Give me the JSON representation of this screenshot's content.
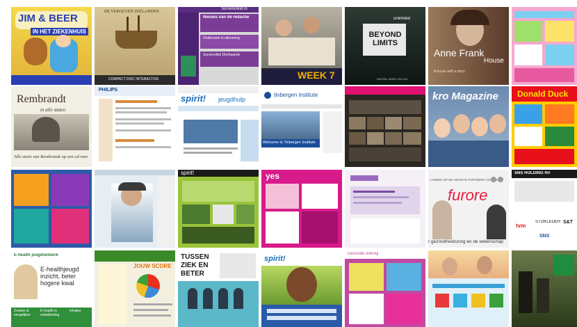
{
  "tiles": {
    "r1c1": {
      "title": "JIM & BEER",
      "subtitle": "IN HET ZIEKENHUIS"
    },
    "r1c2": {
      "title": "DE VERGEVEN ZEELANDEN",
      "subtitle": "COMPACT DISC INTERACTIVE"
    },
    "r1c3": {
      "logo": "Surveoolkid.nl",
      "heading": "Nieuws van de redactie",
      "links": [
        "Onderzoek in uitvoering",
        "Surveoolkid Dierbaarste"
      ]
    },
    "r1c4": {
      "caption": "WEEK 7"
    },
    "r1c5": {
      "label": "unlimited",
      "title": "BEYOND LIMITS",
      "subtitle": "DIGITAL VIDEO ON CD-I"
    },
    "r1c6": {
      "title": "Anne Frank",
      "subtitle": "House",
      "caption": "A house with a story"
    },
    "r2c1": {
      "title": "Rembrandt",
      "subtitle": "in alle staten",
      "footer": "Alle etsen van Rembrandt op een cd-rom"
    },
    "r2c2": {
      "brand": "PHILIPS"
    },
    "r2c3": {
      "logo": "spirit!",
      "tagline": "jeugdhulp"
    },
    "r2c4": {
      "logo": "tinbergen institute",
      "caption": "Welcome to Tinbergen Institute"
    },
    "r2c6": {
      "title": "kro Magazine"
    },
    "r2c7": {
      "title": "Donald Duck"
    },
    "r3c3": {
      "title": "spirit!"
    },
    "r3c4": {
      "logo": "yes"
    },
    "r3c6": {
      "nav": "LANDEN  OP DE HOOGTE  PARTNERS  CONTACT",
      "logo": "furore",
      "caption": "r gezondheidszorg en de wetenschap"
    },
    "r3c7": {
      "header": "SNS HOLDING NV",
      "logos": [
        "tvm",
        "STOKLEDER",
        "S&T",
        "SNS"
      ]
    },
    "r4c1": {
      "logo": "E-health jeugdnetwerk",
      "headline": "E-healthjeugd inzicht, beter hogere kwal",
      "links": [
        "Zoeken & vergelijken",
        "E-health in ontwikkeling",
        "Inhaker"
      ]
    },
    "r4c2": {
      "title": "JOUW SCORE"
    },
    "r4c3": {
      "title": "TUSSEN ZIEK EN BETER"
    },
    "r4c4": {
      "logo": "spirit!"
    },
    "r4c5": {
      "logo": "Gezonde leefstijl"
    }
  }
}
